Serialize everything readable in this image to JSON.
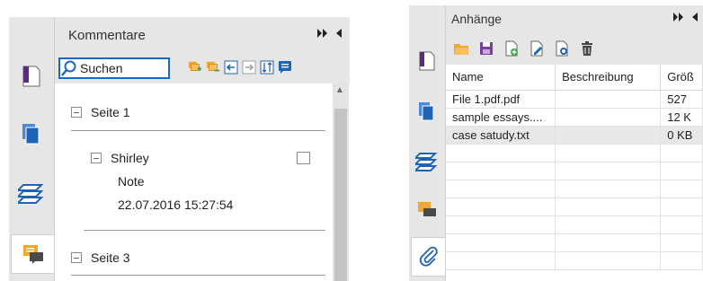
{
  "comments_panel": {
    "title": "Kommentare",
    "search_placeholder": "Suchen",
    "pages": [
      {
        "label": "Seite 1"
      },
      {
        "label": "Seite 3"
      }
    ],
    "comment": {
      "author": "Shirley",
      "type": "Note",
      "timestamp": "22.07.2016 15:27:54"
    }
  },
  "attachments_panel": {
    "title": "Anhänge",
    "columns": [
      "Name",
      "Beschreibung",
      "Größ"
    ],
    "rows": [
      {
        "name": "File 1.pdf.pdf",
        "description": "",
        "size": "527"
      },
      {
        "name": "sample essays....",
        "description": "",
        "size": "12 K"
      },
      {
        "name": "case satudy.txt",
        "description": "",
        "size": "0 KB"
      }
    ]
  },
  "colors": {
    "panel_bg": "#e6e6e6",
    "search_border": "#1a66c9",
    "icon_orange": "#f0a830",
    "icon_blue": "#1e63b5",
    "icon_green": "#3aa548",
    "icon_purple": "#7b3fa0"
  }
}
